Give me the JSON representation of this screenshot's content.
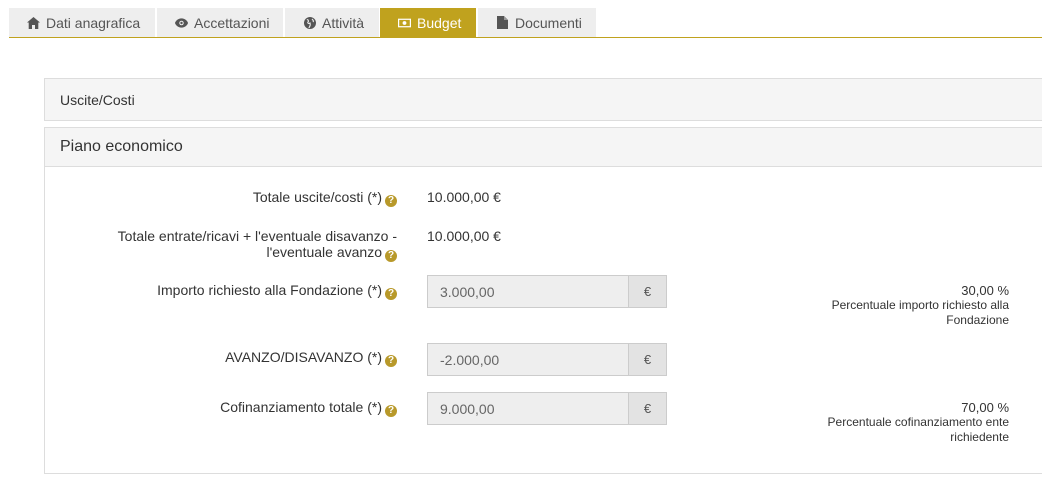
{
  "tabs": [
    {
      "label": "Dati anagrafica",
      "icon": "home-icon"
    },
    {
      "label": "Accettazioni",
      "icon": "eye-icon"
    },
    {
      "label": "Attività",
      "icon": "globe-icon"
    },
    {
      "label": "Budget",
      "icon": "money-icon",
      "active": true
    },
    {
      "label": "Documenti",
      "icon": "file-icon"
    }
  ],
  "panels": {
    "costs_title": "Uscite/Costi",
    "plan_title": "Piano economico"
  },
  "fields": {
    "totale_uscite": {
      "label": "Totale uscite/costi (*)",
      "value": "10.000,00 €"
    },
    "totale_entrate": {
      "label_line1": "Totale entrate/ricavi + l'eventuale disavanzo -",
      "label_line2": "l'eventuale avanzo",
      "value": "10.000,00 €"
    },
    "importo_richiesto": {
      "label": "Importo richiesto alla Fondazione (*)",
      "value": "3.000,00",
      "addon": "€",
      "pct": "30,00 %",
      "pct_line1": "Percentuale importo richiesto alla",
      "pct_line2": "Fondazione"
    },
    "avanzo": {
      "label": "AVANZO/DISAVANZO (*)",
      "value": "-2.000,00",
      "addon": "€"
    },
    "cofinanziamento": {
      "label": "Cofinanziamento totale (*)",
      "value": "9.000,00",
      "addon": "€",
      "pct": "70,00 %",
      "pct_line1": "Percentuale cofinanziamento ente",
      "pct_line2": "richiedente"
    }
  },
  "help_glyph": "?",
  "colors": {
    "accent": "#c0a21e",
    "help_icon": "#b8992a"
  }
}
